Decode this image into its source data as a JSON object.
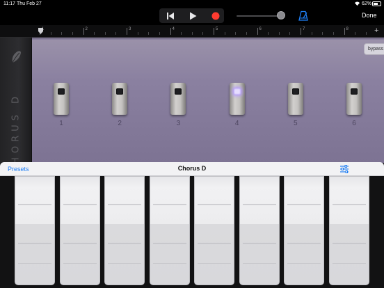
{
  "status_bar": {
    "time": "11:17",
    "date": "Thu Feb 27",
    "battery": "62%",
    "battery_level": 0.62
  },
  "control_bar": {
    "done_label": "Done",
    "volume_level": 0.94,
    "icons": [
      "rewind-icon",
      "play-icon",
      "record-icon",
      "metronome-icon"
    ],
    "colors": {
      "record": "#ff3b30",
      "accent": "#1f7ff5"
    }
  },
  "ruler": {
    "bars": [
      "1",
      "2",
      "3",
      "4",
      "5",
      "6",
      "7",
      "8"
    ],
    "add_label": "+"
  },
  "plugin": {
    "name": "CHORUS D",
    "bypass": {
      "label": "bypass",
      "state": "on"
    },
    "switches": [
      {
        "label": "1",
        "active": false
      },
      {
        "label": "2",
        "active": false
      },
      {
        "label": "3",
        "active": false
      },
      {
        "label": "4",
        "active": true
      },
      {
        "label": "5",
        "active": false
      },
      {
        "label": "6",
        "active": false
      }
    ],
    "colors": {
      "panel": "#8a80a0",
      "led_active": "#b79bff"
    }
  },
  "preset_bar": {
    "presets_label": "Presets",
    "title": "Chorus D"
  },
  "pads": {
    "count": 8
  }
}
